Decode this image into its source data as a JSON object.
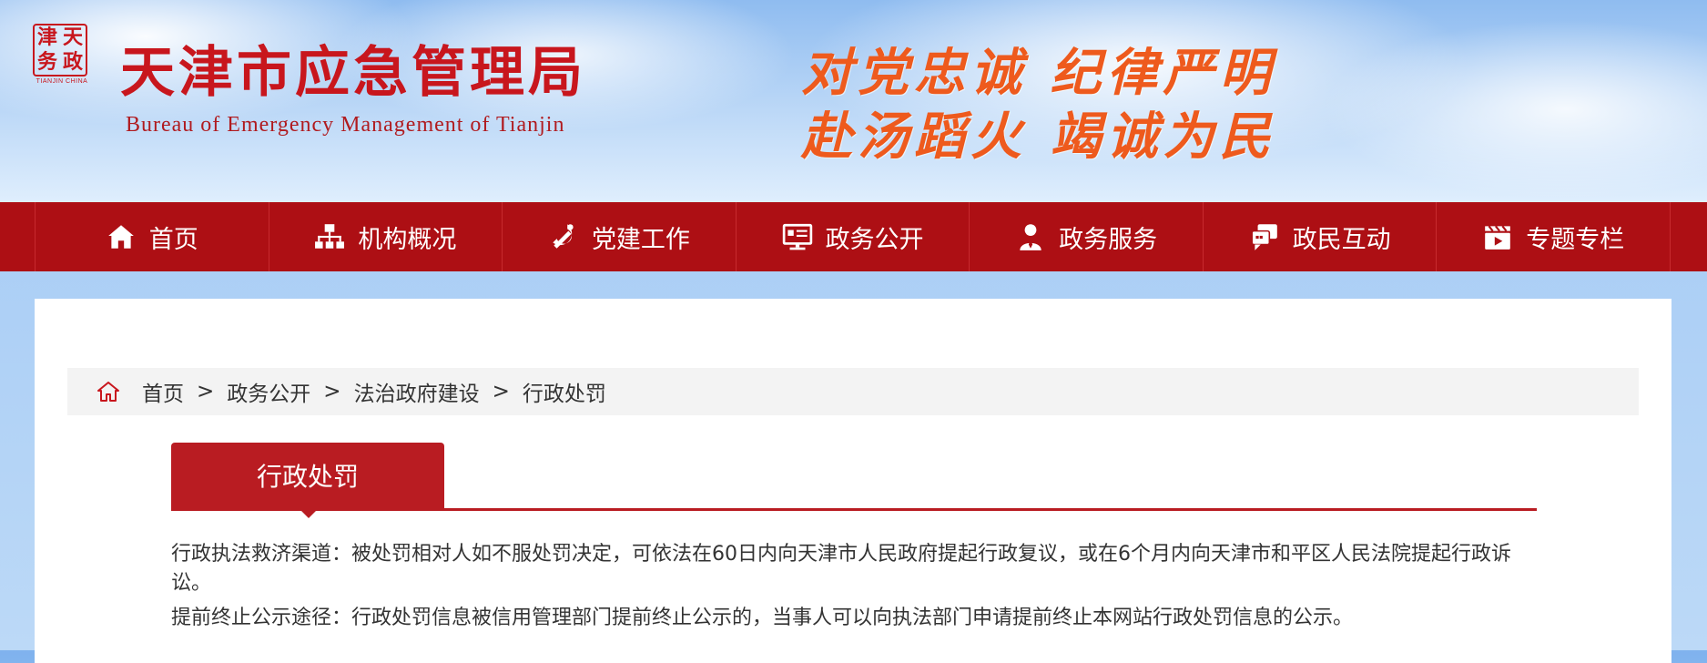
{
  "header": {
    "seal_text": [
      "天",
      "津",
      "政",
      "务"
    ],
    "seal_sub": "TIANJIN CHINA",
    "title": "天津市应急管理局",
    "subtitle": "Bureau  of  Emergency  Management  of  Tianjin",
    "slogan_line1": "对党忠诚  纪律严明",
    "slogan_line2": "赴汤蹈火  竭诚为民"
  },
  "nav": {
    "items": [
      {
        "label": "首页",
        "icon": "home-icon"
      },
      {
        "label": "机构概况",
        "icon": "org-chart-icon"
      },
      {
        "label": "党建工作",
        "icon": "party-emblem-icon"
      },
      {
        "label": "政务公开",
        "icon": "presentation-screen-icon"
      },
      {
        "label": "政务服务",
        "icon": "person-service-icon"
      },
      {
        "label": "政民互动",
        "icon": "chat-bubbles-icon"
      },
      {
        "label": "专题专栏",
        "icon": "clapperboard-icon"
      }
    ]
  },
  "breadcrumb": {
    "items": [
      "首页",
      "政务公开",
      "法治政府建设",
      "行政处罚"
    ],
    "separator": ">"
  },
  "section": {
    "title": "行政处罚"
  },
  "notice": {
    "line1": "行政执法救济渠道：被处罚相对人如不服处罚决定，可依法在60日内向天津市人民政府提起行政复议，或在6个月内向天津市和平区人民法院提起行政诉讼。",
    "line2": "提前终止公示途径：行政处罚信息被信用管理部门提前终止公示的，当事人可以向执法部门申请提前终止本网站行政处罚信息的公示。"
  },
  "colors": {
    "brand_red": "#ad0f14",
    "accent_red": "#b91c22",
    "slogan_orange": "#ee5a1d"
  }
}
